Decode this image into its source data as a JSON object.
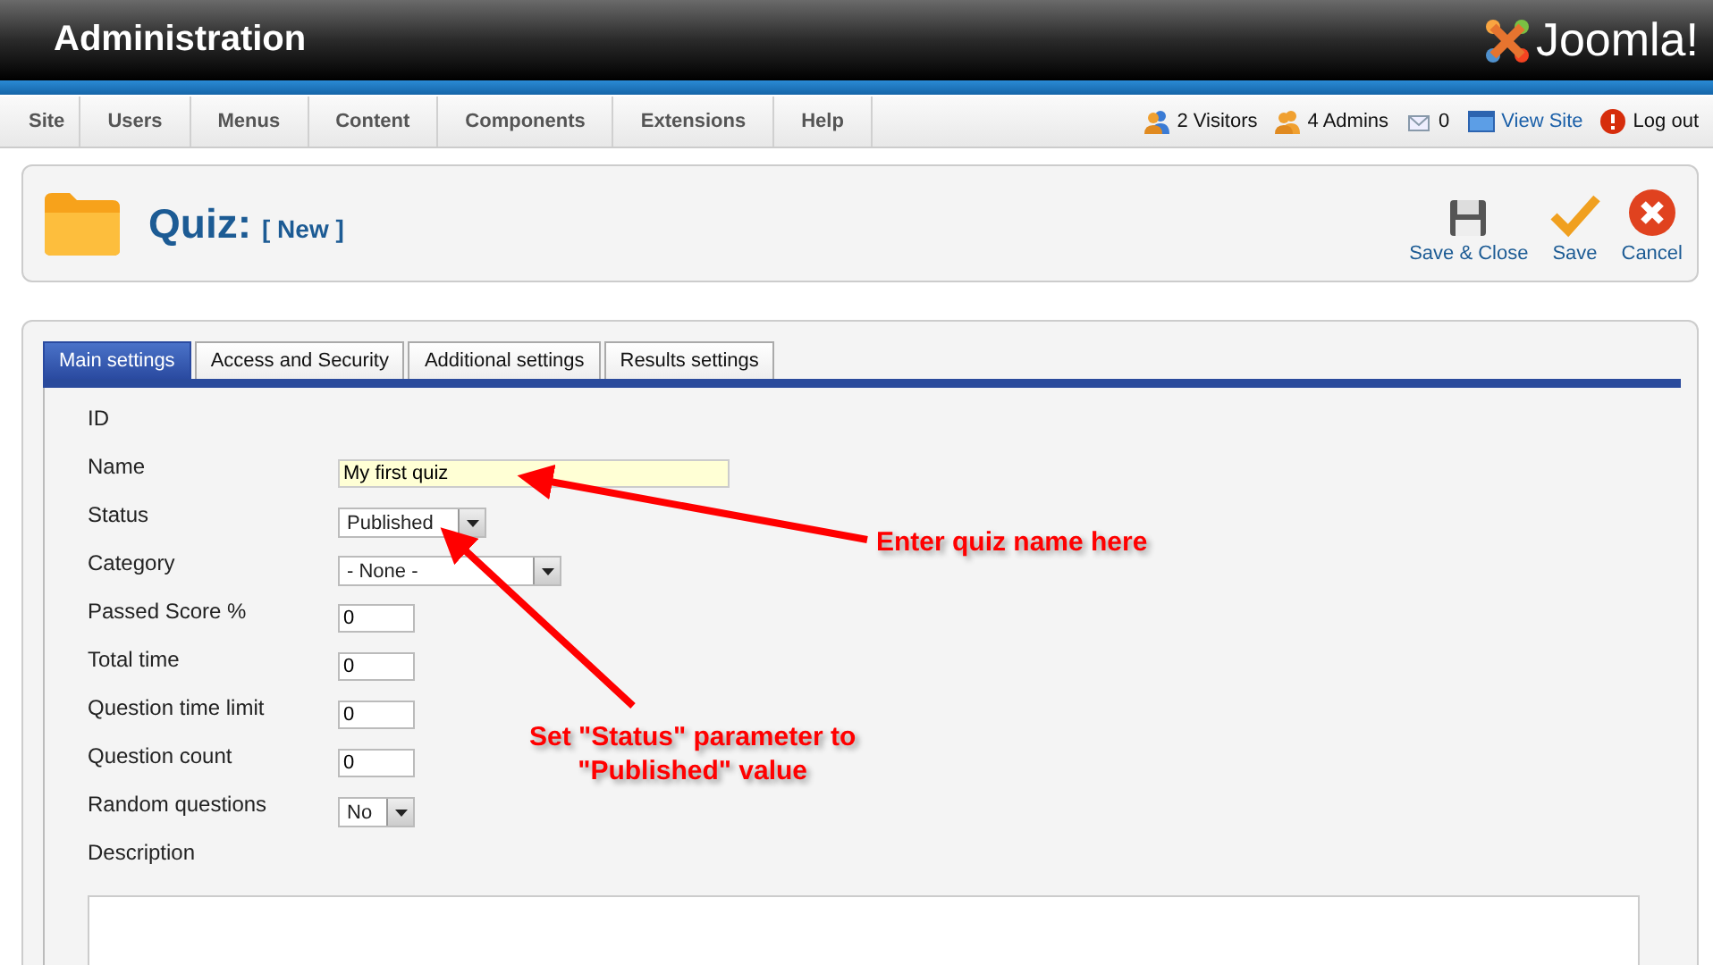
{
  "header": {
    "title": "Administration",
    "logo_text": "Joomla!"
  },
  "menu": [
    "Site",
    "Users",
    "Menus",
    "Content",
    "Components",
    "Extensions",
    "Help"
  ],
  "status_items": [
    {
      "kind": "visitors",
      "label": "2 Visitors",
      "link": false
    },
    {
      "kind": "admins",
      "label": "4 Admins",
      "link": false
    },
    {
      "kind": "messages",
      "label": "0",
      "link": false
    },
    {
      "kind": "view-site",
      "label": "View Site",
      "link": true
    },
    {
      "kind": "logout",
      "label": "Log out",
      "link": false
    }
  ],
  "toolbar": {
    "title": "Quiz:",
    "subtitle": "[ New ]",
    "buttons": [
      {
        "kind": "save-close",
        "label": "Save & Close"
      },
      {
        "kind": "save",
        "label": "Save"
      },
      {
        "kind": "cancel",
        "label": "Cancel"
      }
    ]
  },
  "tabs": [
    {
      "label": "Main settings",
      "selected": true
    },
    {
      "label": "Access and Security",
      "selected": false
    },
    {
      "label": "Additional settings",
      "selected": false
    },
    {
      "label": "Results settings",
      "selected": false
    }
  ],
  "fields": [
    {
      "label": "ID",
      "kind": "static"
    },
    {
      "label": "Name",
      "kind": "text",
      "value": "My first quiz",
      "focused": true
    },
    {
      "label": "Status",
      "kind": "select",
      "value": "Published"
    },
    {
      "label": "Category",
      "kind": "select",
      "value": "- None -"
    },
    {
      "label": "Passed Score %",
      "kind": "text",
      "value": "0",
      "focused": false
    },
    {
      "label": "Total time",
      "kind": "text",
      "value": "0",
      "focused": false
    },
    {
      "label": "Question time limit",
      "kind": "text",
      "value": "0",
      "focused": false
    },
    {
      "label": "Question count",
      "kind": "text",
      "value": "0",
      "focused": false
    },
    {
      "label": "Random questions",
      "kind": "select",
      "value": "No"
    }
  ],
  "description": {
    "label": "Description"
  },
  "annotations": [
    {
      "lines": [
        "Enter quiz name here"
      ]
    },
    {
      "lines": [
        "Set \"Status\" parameter to",
        "\"Published\" value"
      ]
    }
  ]
}
